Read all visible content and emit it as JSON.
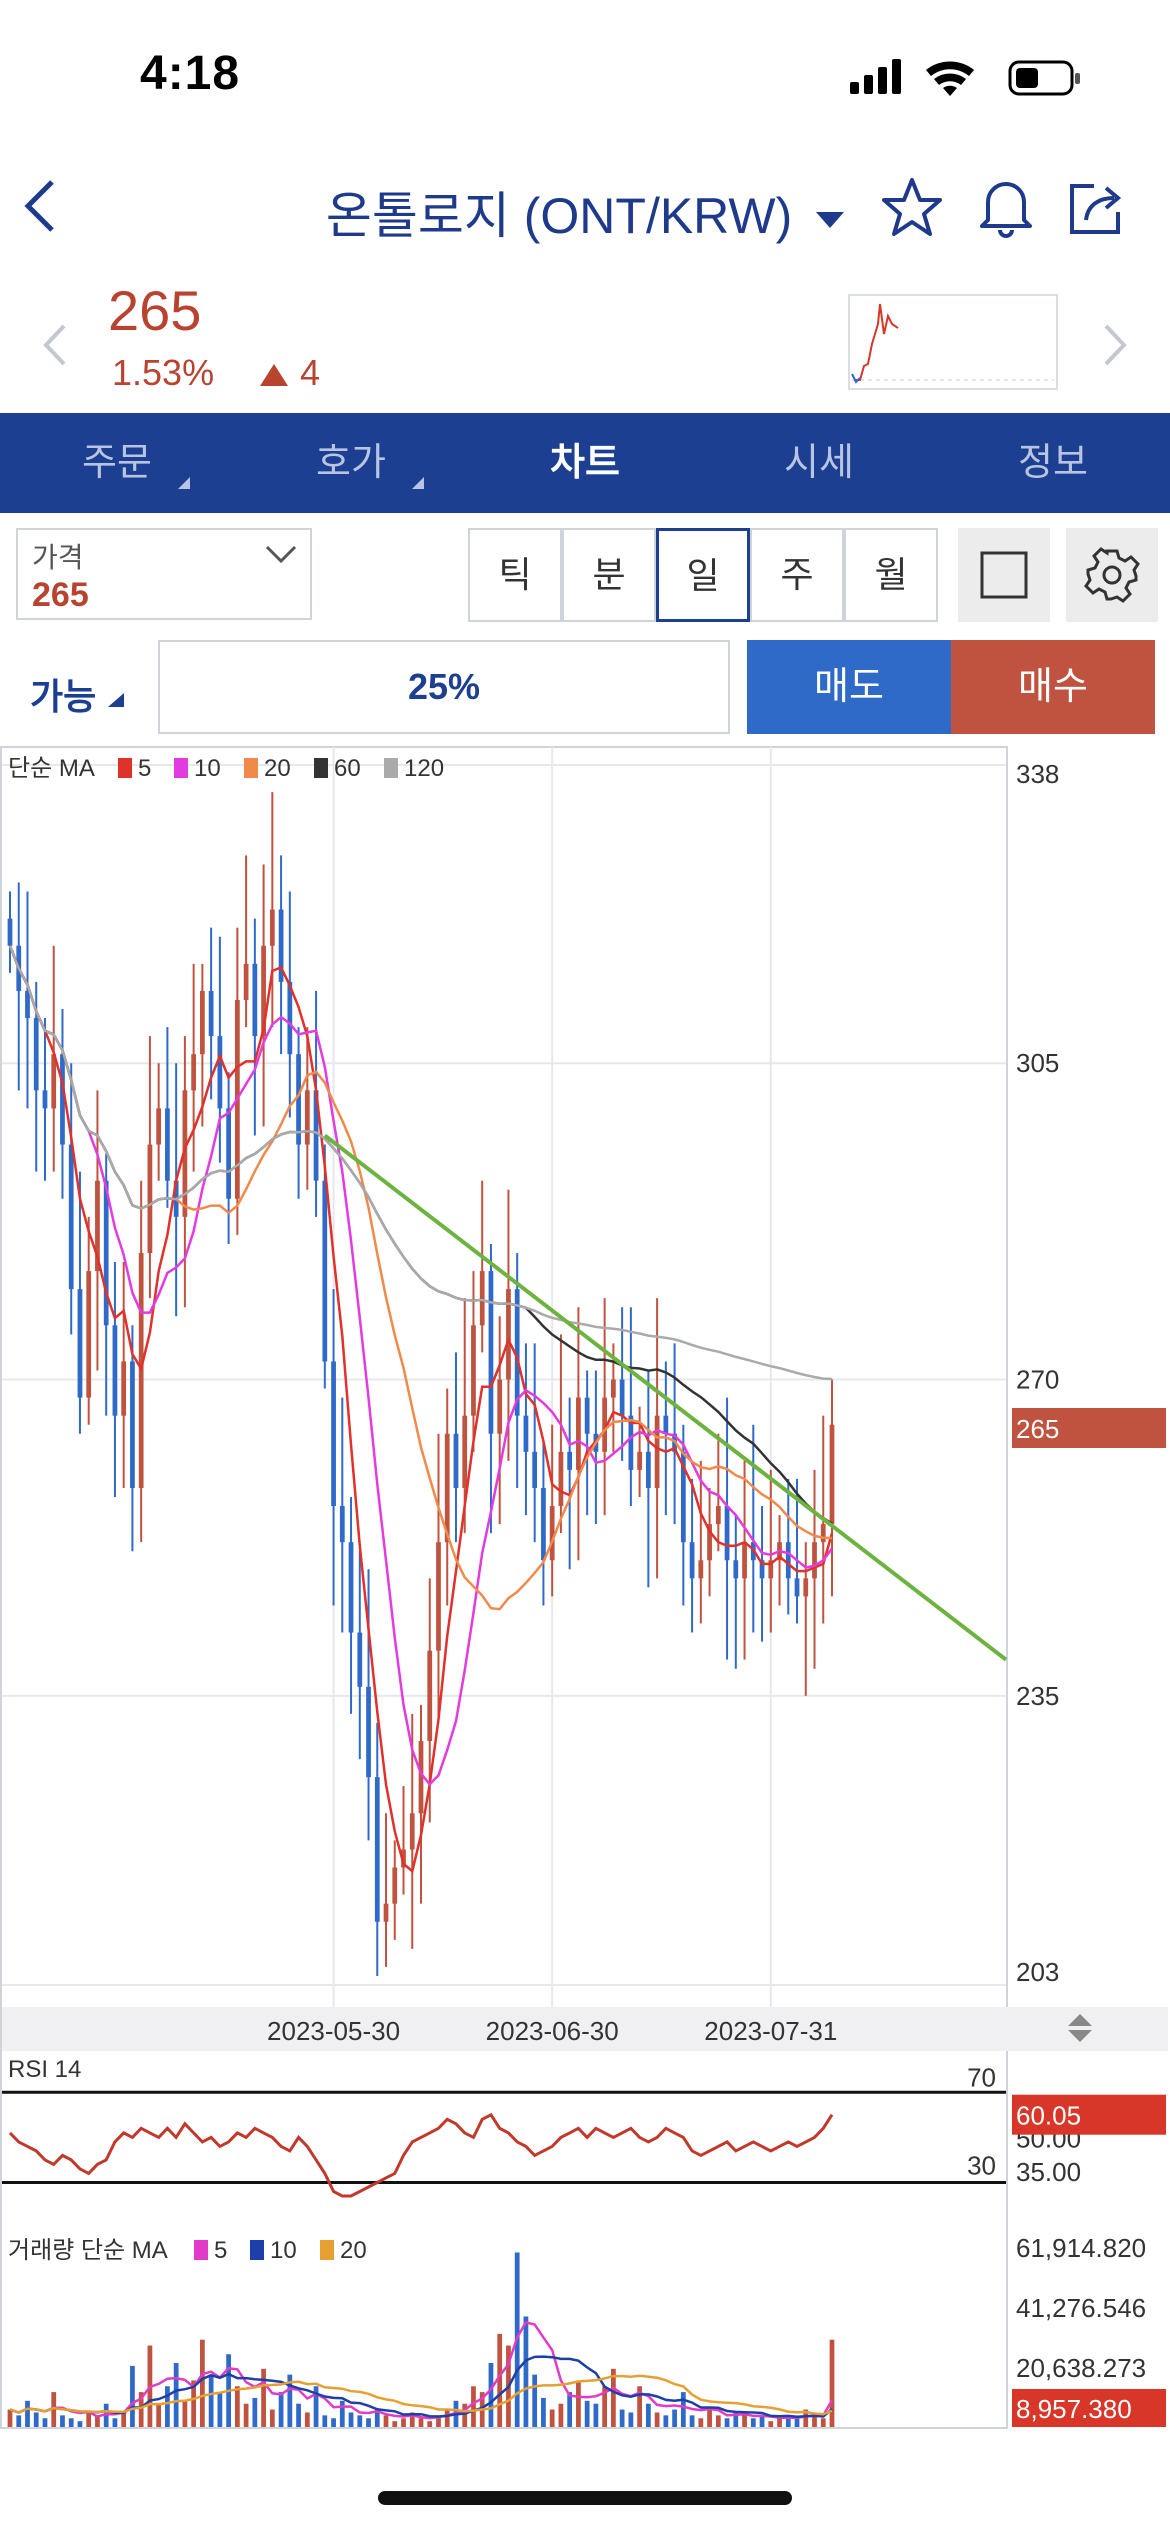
{
  "status_bar": {
    "time": "4:18"
  },
  "header": {
    "title": "온톨로지 (ONT/KRW)"
  },
  "ticker": {
    "price": "265",
    "change_pct": "1.53%",
    "change_amt": "4"
  },
  "nav": {
    "tabs": [
      {
        "label": "주문",
        "active": false,
        "has_menu": true
      },
      {
        "label": "호가",
        "active": false,
        "has_menu": true
      },
      {
        "label": "차트",
        "active": true,
        "has_menu": false
      },
      {
        "label": "시세",
        "active": false,
        "has_menu": false
      },
      {
        "label": "정보",
        "active": false,
        "has_menu": false
      }
    ]
  },
  "controls": {
    "price_label": "가격",
    "price_value": "265",
    "periods": [
      "틱",
      "분",
      "일",
      "주",
      "월"
    ],
    "selected_period": "일",
    "available_label": "가능",
    "percent": "25%",
    "sell_label": "매도",
    "buy_label": "매수"
  },
  "colors": {
    "up": "#c0533f",
    "down": "#2f6ac9",
    "nav_bg": "#1c3f91",
    "trend": "#6db33f"
  },
  "chart_data": [
    {
      "type": "candlestick",
      "legend": {
        "title": "단순 MA",
        "periods": [
          5,
          10,
          20,
          60,
          120
        ],
        "colors": [
          "#e0312b",
          "#e23be0",
          "#f08a4b",
          "#333333",
          "#aaaaaa"
        ]
      },
      "y_ticks": [
        "338",
        "305",
        "270",
        "235",
        "203"
      ],
      "ylim": [
        203,
        338
      ],
      "x_ticks": [
        "2023-05-30",
        "2023-06-30",
        "2023-07-31"
      ],
      "current_price_label": "265",
      "close": [
        318,
        313,
        310,
        302,
        300,
        306,
        296,
        280,
        268,
        282,
        292,
        276,
        266,
        272,
        258,
        284,
        296,
        300,
        292,
        288,
        302,
        306,
        313,
        308,
        300,
        290,
        312,
        316,
        308,
        318,
        322,
        314,
        306,
        296,
        302,
        292,
        272,
        256,
        252,
        242,
        236,
        226,
        210,
        212,
        216,
        218,
        222,
        230,
        240,
        252,
        264,
        258,
        266,
        276,
        282,
        264,
        270,
        280,
        266,
        262,
        258,
        250,
        256,
        262,
        260,
        268,
        264,
        262,
        268,
        270,
        266,
        260,
        262,
        258,
        266,
        264,
        262,
        252,
        248,
        250,
        254,
        256,
        250,
        248,
        252,
        250,
        248,
        250,
        252,
        248,
        246,
        248,
        252,
        254,
        265
      ],
      "trendline": {
        "start": {
          "index": 36,
          "value": 297
        },
        "end_value_at_right_edge": 239
      }
    },
    {
      "type": "line",
      "title": "RSI 14",
      "levels": [
        "70",
        "30"
      ],
      "right_labels": [
        "50.00",
        "35.00"
      ],
      "current_label": "60.05",
      "values": [
        52,
        48,
        46,
        44,
        40,
        38,
        42,
        40,
        36,
        34,
        38,
        40,
        48,
        52,
        50,
        54,
        52,
        50,
        54,
        50,
        56,
        52,
        48,
        50,
        46,
        48,
        52,
        50,
        54,
        52,
        50,
        46,
        44,
        50,
        46,
        40,
        34,
        26,
        24,
        24,
        26,
        28,
        30,
        32,
        34,
        42,
        48,
        50,
        52,
        54,
        58,
        56,
        52,
        50,
        58,
        60,
        54,
        52,
        48,
        46,
        42,
        44,
        46,
        50,
        52,
        54,
        50,
        54,
        52,
        50,
        52,
        54,
        50,
        48,
        50,
        54,
        52,
        50,
        44,
        42,
        44,
        46,
        48,
        44,
        46,
        48,
        46,
        44,
        46,
        48,
        46,
        48,
        50,
        54,
        60.05
      ]
    },
    {
      "type": "bar",
      "title": "거래량 단순 MA",
      "legend": {
        "periods": [
          5,
          10,
          20
        ],
        "colors": [
          "#e23bc8",
          "#1c3fa8",
          "#e6a032"
        ]
      },
      "right_labels": [
        "61,914.820",
        "41,276.546",
        "20,638.273"
      ],
      "current_label": "8,957.380",
      "values": [
        6000,
        4000,
        9000,
        5000,
        3000,
        12000,
        4000,
        3000,
        2000,
        5000,
        4000,
        8000,
        3000,
        5000,
        21000,
        12000,
        28000,
        8000,
        14000,
        22000,
        9000,
        16000,
        30000,
        18000,
        12000,
        25000,
        14000,
        8000,
        10000,
        20000,
        6000,
        12000,
        18000,
        8000,
        5000,
        14000,
        4000,
        3000,
        9000,
        5000,
        4000,
        3000,
        6000,
        4000,
        2000,
        3000,
        5000,
        3000,
        2000,
        4000,
        6000,
        9000,
        8000,
        14000,
        12000,
        22000,
        32000,
        28000,
        60000,
        38000,
        18000,
        10000,
        6000,
        8000,
        12000,
        16000,
        9000,
        8000,
        14000,
        20000,
        6000,
        5000,
        14000,
        8000,
        5000,
        4000,
        6000,
        12000,
        4000,
        3000,
        6000,
        4000,
        3000,
        5000,
        4000,
        3000,
        4000,
        2000,
        3000,
        4000,
        3000,
        6000,
        4000,
        3000,
        30000
      ]
    }
  ]
}
